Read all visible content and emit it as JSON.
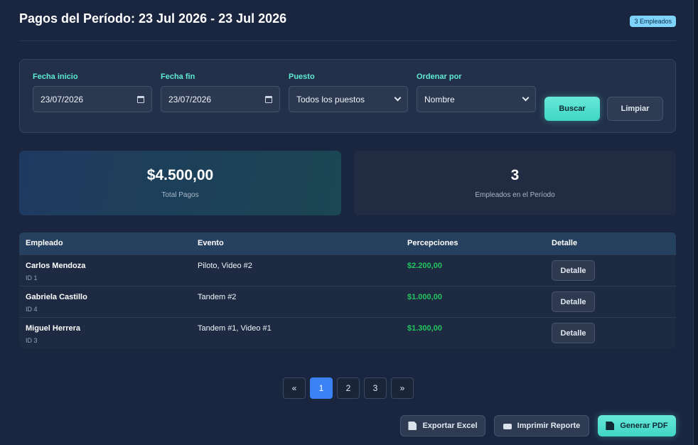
{
  "header": {
    "title": "Pagos del Período: 23 Jul 2026 - 23 Jul 2026",
    "badge": "3 Empleados"
  },
  "filters": {
    "start": {
      "label": "Fecha inicio",
      "value": "23/07/2026"
    },
    "end": {
      "label": "Fecha fin",
      "value": "23/07/2026"
    },
    "position": {
      "label": "Puesto",
      "value": "Todos los puestos"
    },
    "sort": {
      "label": "Ordenar por",
      "value": "Nombre"
    },
    "search_label": "Buscar",
    "clear_label": "Limpiar"
  },
  "stats": {
    "total_value": "$4.500,00",
    "total_label": "Total Pagos",
    "employees_value": "3",
    "employees_label": "Empleados en el Período"
  },
  "table": {
    "headers": [
      "Empleado",
      "Evento",
      "Percepciones",
      "Detalle"
    ],
    "rows": [
      {
        "name": "Carlos Mendoza",
        "id": "ID 1",
        "event": "Piloto, Video #2",
        "amount": "$2.200,00",
        "detail": "Detalle"
      },
      {
        "name": "Gabriela Castillo",
        "id": "ID 4",
        "event": "Tandem #2",
        "amount": "$1.000,00",
        "detail": "Detalle"
      },
      {
        "name": "Miguel Herrera",
        "id": "ID 3",
        "event": "Tandem #1, Video #1",
        "amount": "$1.300,00",
        "detail": "Detalle"
      }
    ]
  },
  "pagination": {
    "prev": "«",
    "pages": [
      "1",
      "2",
      "3"
    ],
    "next": "»",
    "current": "1"
  },
  "actions": {
    "excel": "Exportar Excel",
    "print": "Imprimir Reporte",
    "pdf": "Generar PDF"
  },
  "colors": {
    "accent": "#5eead4",
    "amount": "#22c55e",
    "page_active": "#3b82f6"
  }
}
